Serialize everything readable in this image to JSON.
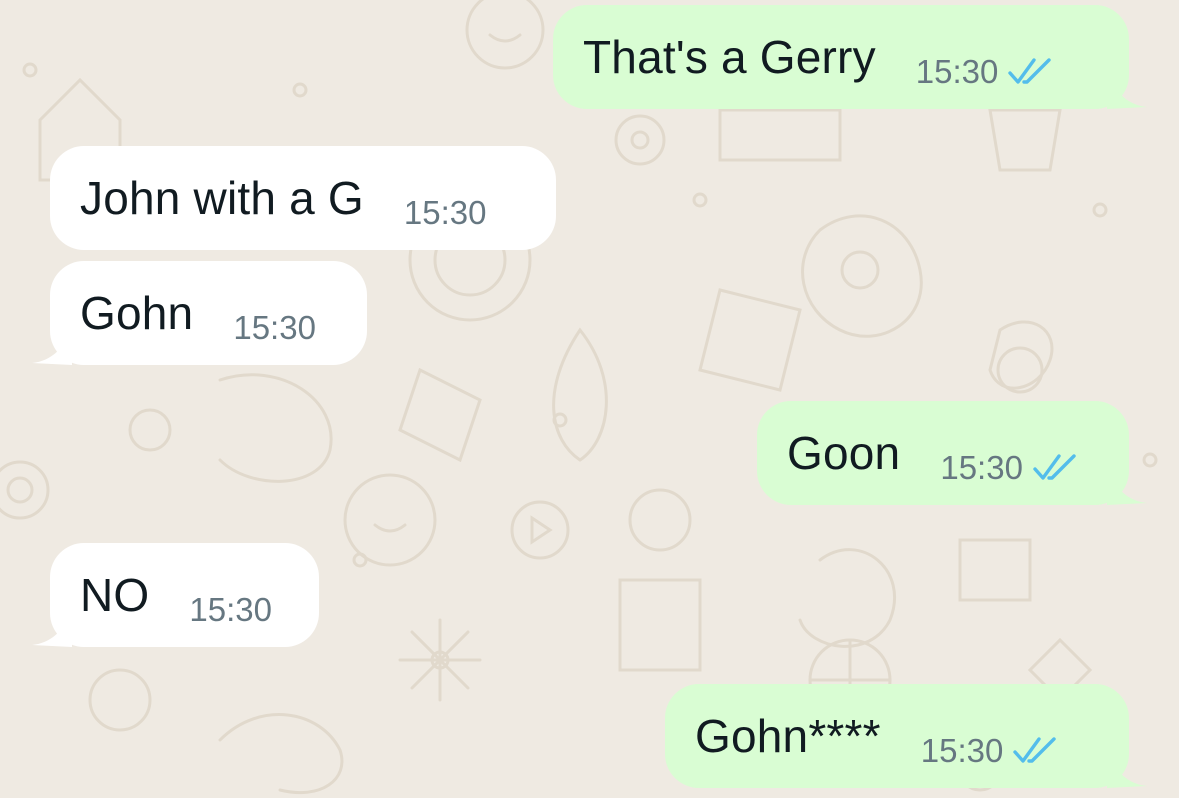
{
  "messages": [
    {
      "direction": "outgoing",
      "text": "That's a Gerry",
      "time": "15:30",
      "status": "read"
    },
    {
      "direction": "incoming",
      "text": "John with a G",
      "time": "15:30"
    },
    {
      "direction": "incoming",
      "text": "Gohn",
      "time": "15:30"
    },
    {
      "direction": "outgoing",
      "text": "Goon",
      "time": "15:30",
      "status": "read"
    },
    {
      "direction": "incoming",
      "text": "NO",
      "time": "15:30"
    },
    {
      "direction": "outgoing",
      "text": "Gohn****",
      "time": "15:30",
      "status": "read"
    }
  ],
  "colors": {
    "background": "#efeae2",
    "incoming_bubble": "#ffffff",
    "outgoing_bubble": "#d9fdd3",
    "read_ticks": "#53bdeb",
    "time_text": "#667781"
  },
  "icons": {
    "read_receipt": "double-check-icon"
  }
}
